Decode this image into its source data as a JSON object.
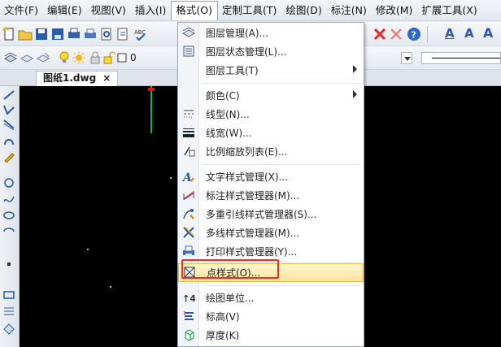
{
  "menubar": {
    "items": [
      {
        "label": "文件(F)"
      },
      {
        "label": "编辑(E)"
      },
      {
        "label": "视图(V)"
      },
      {
        "label": "插入(I)"
      },
      {
        "label": "格式(O)"
      },
      {
        "label": "定制工具(T)"
      },
      {
        "label": "绘图(D)"
      },
      {
        "label": "标注(N)"
      },
      {
        "label": "修改(M)"
      },
      {
        "label": "扩展工具(X)"
      }
    ]
  },
  "toolbar": {
    "layer_value": "0",
    "text_a1": "A",
    "text_a2": "A",
    "text_a3": "A"
  },
  "tab": {
    "title": "图纸1.dwg",
    "close": "×"
  },
  "format_menu": {
    "items": [
      {
        "label": "图层管理(A)...",
        "icon": "layer-manager-icon"
      },
      {
        "label": "图层状态管理(L)...",
        "icon": "layer-state-icon"
      },
      {
        "label": "图层工具(T)",
        "icon": "",
        "submenu": true
      },
      {
        "label": "颜色(C)",
        "icon": "",
        "submenu": true
      },
      {
        "label": "线型(N)...",
        "icon": "linetype-icon"
      },
      {
        "label": "线宽(W)...",
        "icon": "lineweight-icon"
      },
      {
        "label": "比例缩放列表(E)...",
        "icon": "scale-list-icon"
      },
      {
        "label": "文字样式管理(X)...",
        "icon": "text-style-icon"
      },
      {
        "label": "标注样式管理器(M)...",
        "icon": "dim-style-icon"
      },
      {
        "label": "多重引线样式管理器(S)...",
        "icon": "mleader-style-icon"
      },
      {
        "label": "多线样式管理器(M)...",
        "icon": "mline-style-icon"
      },
      {
        "label": "打印样式管理器(Y)...",
        "icon": "plot-style-icon"
      },
      {
        "label": "点样式(O)...",
        "icon": "point-style-icon"
      },
      {
        "label": "绘图单位...",
        "icon": "units-icon"
      },
      {
        "label": "标高(V)",
        "icon": "elevation-icon"
      },
      {
        "label": "厚度(K)",
        "icon": "thickness-icon"
      }
    ]
  }
}
